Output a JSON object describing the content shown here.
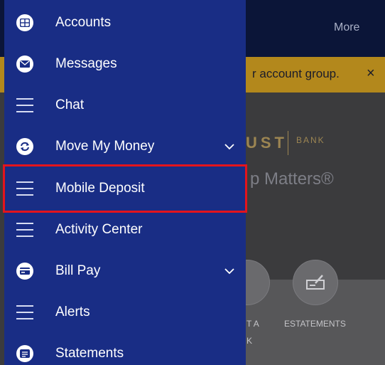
{
  "background": {
    "header_more": "More",
    "banner_text": "r account group.",
    "banner_close": "×",
    "brand_text": "UST",
    "brand_sub": "BANK",
    "tagline": "p Matters®",
    "action_label_1": "T A",
    "action_label_1b": "K",
    "action_label_2": "ESTATEMENTS"
  },
  "drawer": {
    "items": [
      {
        "label": "Accounts",
        "icon": "accounts-icon",
        "has_chevron": false
      },
      {
        "label": "Messages",
        "icon": "envelope-icon",
        "has_chevron": false
      },
      {
        "label": "Chat",
        "icon": "menu-lines-icon",
        "has_chevron": false
      },
      {
        "label": "Move My Money",
        "icon": "transfer-icon",
        "has_chevron": true
      },
      {
        "label": "Mobile Deposit",
        "icon": "menu-lines-icon",
        "has_chevron": false,
        "highlighted": true
      },
      {
        "label": "Activity Center",
        "icon": "menu-lines-icon",
        "has_chevron": false
      },
      {
        "label": "Bill Pay",
        "icon": "card-icon",
        "has_chevron": true
      },
      {
        "label": "Alerts",
        "icon": "menu-lines-icon",
        "has_chevron": false
      },
      {
        "label": "Statements",
        "icon": "statement-icon",
        "has_chevron": false
      }
    ],
    "chevron_glyph": "⌄"
  },
  "colors": {
    "drawer_bg": "#192d85",
    "highlight_border": "#e4141c",
    "banner": "#b3881c"
  }
}
